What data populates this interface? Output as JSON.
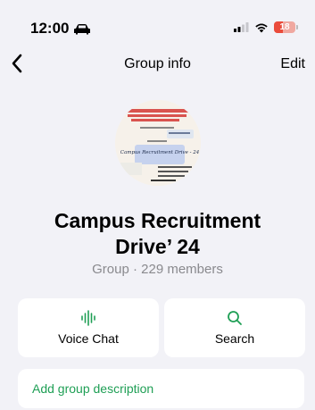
{
  "status_bar": {
    "time": "12:00",
    "battery_level": "18",
    "car_icon": "car-icon",
    "signal_icon": "cellular-signal-icon",
    "wifi_icon": "wifi-icon",
    "battery_icon": "battery-icon"
  },
  "nav": {
    "back_icon": "chevron-left-icon",
    "title": "Group info",
    "edit_label": "Edit"
  },
  "group": {
    "name_line1": "Campus Recruitment",
    "name_line2": "Drive’ 24",
    "meta": "Group · 229 members",
    "avatar": {
      "poster_title": "Campus Recruitment Drive - 24"
    }
  },
  "actions": {
    "voice_chat_label": "Voice Chat",
    "voice_chat_icon": "audio-waveform-icon",
    "search_label": "Search",
    "search_icon": "search-icon"
  },
  "description": {
    "add_label": "Add group description"
  },
  "colors": {
    "accent": "#1f9f55",
    "background": "#f2f2f7",
    "card": "#ffffff",
    "secondary_text": "#8a8a8e"
  }
}
